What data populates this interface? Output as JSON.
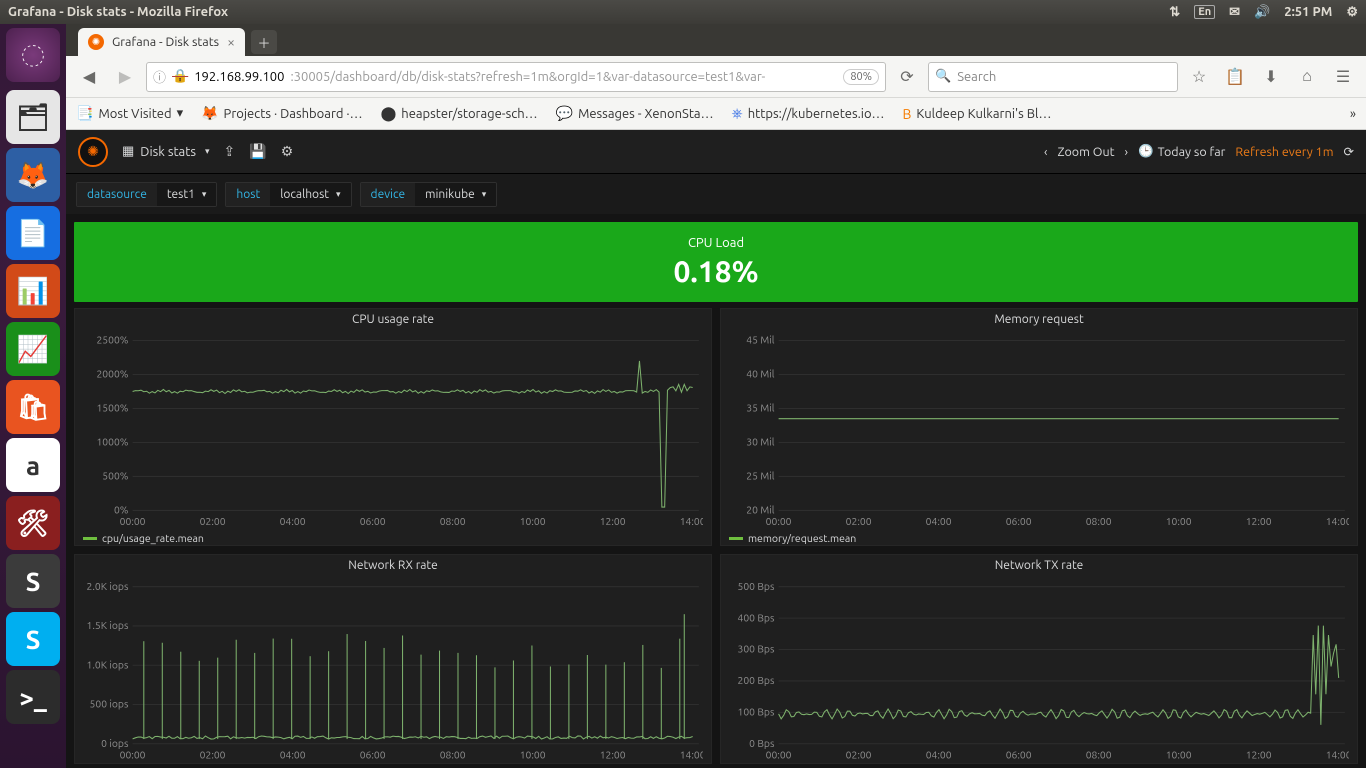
{
  "os": {
    "window_title": "Grafana - Disk stats - Mozilla Firefox",
    "lang": "En",
    "clock": "2:51 PM"
  },
  "launcher_items": [
    {
      "name": "files",
      "bg": "#e6e6e6",
      "glyph": "🗂"
    },
    {
      "name": "firefox",
      "bg": "#2d5fa4",
      "glyph": "🦊"
    },
    {
      "name": "writer",
      "bg": "#166ee1",
      "glyph": "📄"
    },
    {
      "name": "impress",
      "bg": "#d24a18",
      "glyph": "📊"
    },
    {
      "name": "calc",
      "bg": "#1a8f1a",
      "glyph": "📈"
    },
    {
      "name": "software",
      "bg": "#e95420",
      "glyph": "🛍"
    },
    {
      "name": "amazon",
      "bg": "#ffffff",
      "glyph": "a"
    },
    {
      "name": "settings",
      "bg": "#8a1f1f",
      "glyph": "🛠"
    },
    {
      "name": "sublime",
      "bg": "#3b3b3b",
      "glyph": "S"
    },
    {
      "name": "skype",
      "bg": "#00aff0",
      "glyph": "S"
    },
    {
      "name": "terminal",
      "bg": "#2c2c2c",
      "glyph": ">_"
    }
  ],
  "browser": {
    "tab_title": "Grafana - Disk stats",
    "url_host": "192.168.99.100",
    "url_rest": ":30005/dashboard/db/disk-stats?refresh=1m&orgId=1&var-datasource=test1&var-",
    "zoom": "80%",
    "search_placeholder": "Search"
  },
  "bookmarks": [
    {
      "icon": "📑",
      "label": "Most Visited",
      "caret": true
    },
    {
      "icon": "🦊",
      "label": "Projects · Dashboard ·…",
      "color": "#e25600"
    },
    {
      "icon": "⬤",
      "label": "heapster/storage-sch…"
    },
    {
      "icon": "💬",
      "label": "Messages - XenonSta…",
      "color": "#d6472f"
    },
    {
      "icon": "⎈",
      "label": "https://kubernetes.io…",
      "color": "#326ce5"
    },
    {
      "icon": "B",
      "label": "Kuldeep Kulkarni's Bl…",
      "color": "#f57c00"
    }
  ],
  "grafana": {
    "dash_title": "Disk stats",
    "zoom_label": "Zoom Out",
    "range_label": "Today so far",
    "refresh_label": "Refresh every 1m",
    "vars": [
      {
        "key": "datasource",
        "value": "test1"
      },
      {
        "key": "host",
        "value": "localhost"
      },
      {
        "key": "device",
        "value": "minikube"
      }
    ],
    "cpu_load": {
      "label": "CPU Load",
      "value": "0.18%"
    },
    "panels": {
      "cpu_usage": {
        "title": "CPU usage rate",
        "legend": "cpu/usage_rate.mean"
      },
      "mem_request": {
        "title": "Memory request",
        "legend": "memory/request.mean"
      },
      "net_rx": {
        "title": "Network RX rate",
        "legend": ""
      },
      "net_tx": {
        "title": "Network TX rate",
        "legend": ""
      }
    }
  },
  "chart_data": [
    {
      "id": "cpu_usage",
      "type": "line",
      "title": "CPU usage rate",
      "xlabel": "",
      "ylabel": "",
      "ylim": [
        0,
        2500
      ],
      "yticks": [
        "0%",
        "500%",
        "1000%",
        "1500%",
        "2000%",
        "2500%"
      ],
      "xticks": [
        "00:00",
        "02:00",
        "04:00",
        "06:00",
        "08:00",
        "10:00",
        "12:00",
        "14:00"
      ],
      "series": [
        {
          "name": "cpu/usage_rate.mean",
          "approx_constant": 1750,
          "notes": "flat ~1750% with jitter until ~13:30, brief dip to ~0 then spike to ~2200 then settle ~1800"
        }
      ]
    },
    {
      "id": "mem_request",
      "type": "line",
      "title": "Memory request",
      "ylim": [
        20,
        45
      ],
      "yticks": [
        "20 Mil",
        "25 Mil",
        "30 Mil",
        "35 Mil",
        "40 Mil",
        "45 Mil"
      ],
      "xticks": [
        "00:00",
        "02:00",
        "04:00",
        "06:00",
        "08:00",
        "10:00",
        "12:00",
        "14:00"
      ],
      "series": [
        {
          "name": "memory/request.mean",
          "approx_constant": 33.5
        }
      ]
    },
    {
      "id": "net_rx",
      "type": "bar",
      "title": "Network RX rate",
      "ylim": [
        0,
        2000
      ],
      "yticks": [
        "0 iops",
        "500 iops",
        "1.0K iops",
        "1.5K iops",
        "2.0K iops"
      ],
      "xticks": [
        "00:00",
        "02:00",
        "04:00",
        "06:00",
        "08:00",
        "10:00",
        "12:00",
        "14:00"
      ],
      "notes": "baseline ~50–100 iops with periodic narrow spikes every ~30min to 1.0–1.5K iops; late spike ~1.6K"
    },
    {
      "id": "net_tx",
      "type": "line",
      "title": "Network TX rate",
      "ylim": [
        0,
        500
      ],
      "yticks": [
        "0 Bps",
        "100 Bps",
        "200 Bps",
        "300 Bps",
        "400 Bps",
        "500 Bps"
      ],
      "xticks": [
        "00:00",
        "02:00",
        "04:00",
        "06:00",
        "08:00",
        "10:00",
        "12:00",
        "14:00"
      ],
      "notes": "hovers ~90–100 Bps with small jitter until ~14:20 then bursts between ~60–380 Bps"
    }
  ]
}
